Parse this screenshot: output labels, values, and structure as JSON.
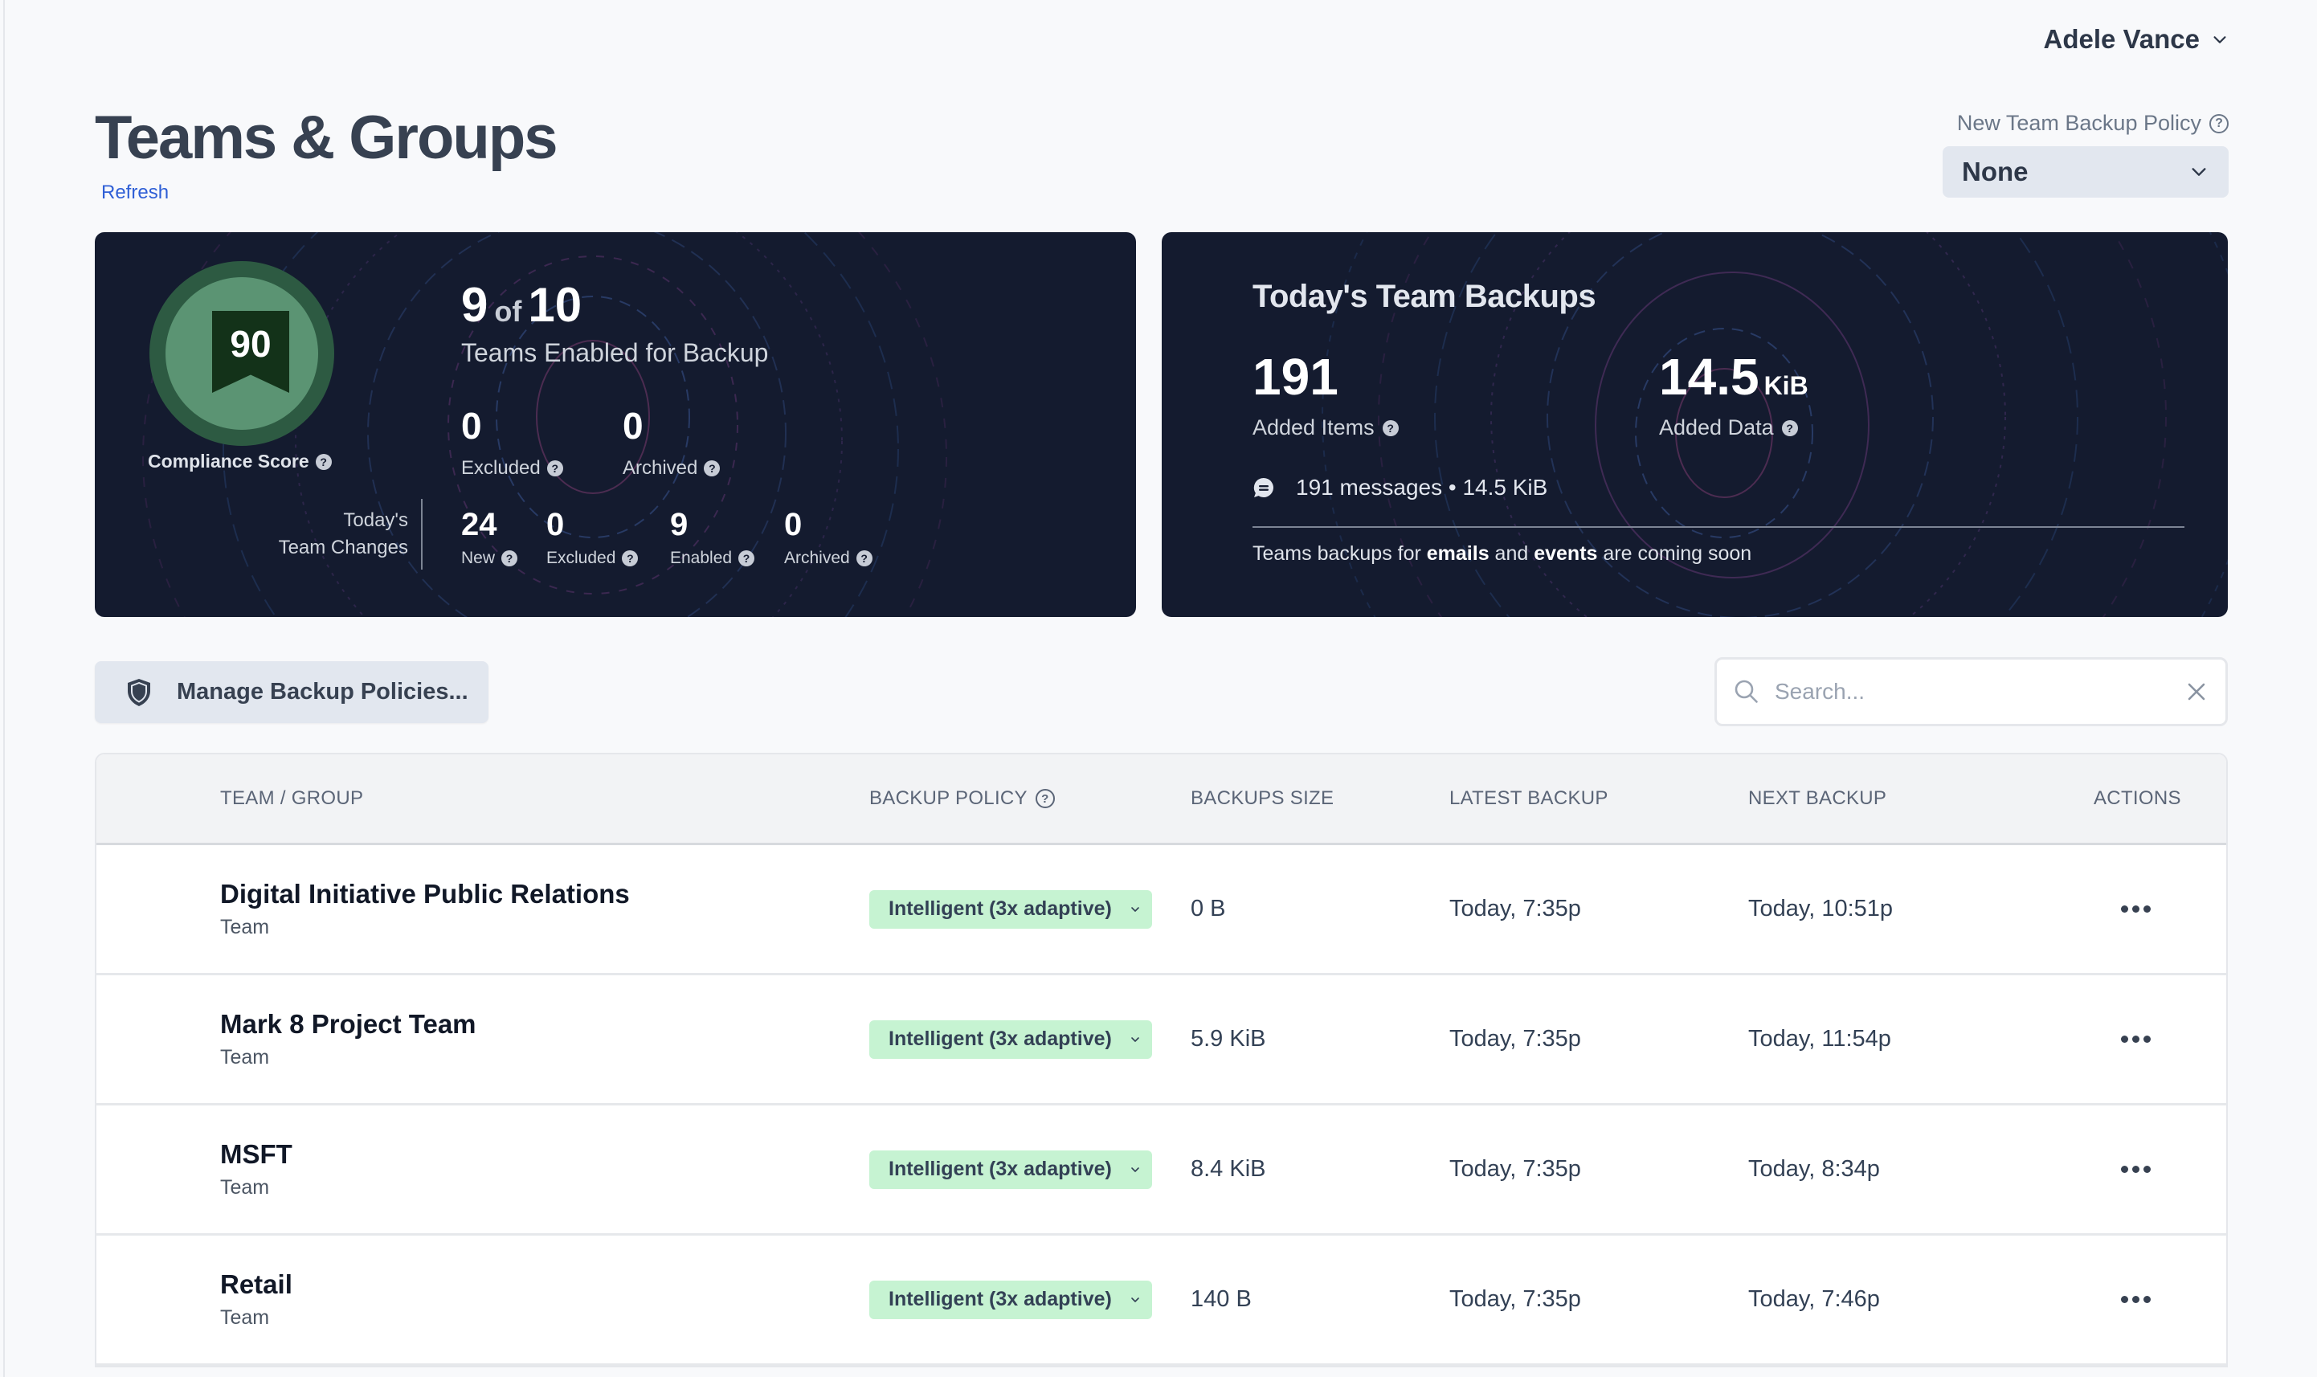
{
  "header": {
    "user_name": "Adele Vance",
    "page_title": "Teams & Groups",
    "refresh_label": "Refresh",
    "new_policy_label": "New Team Backup Policy",
    "new_policy_value": "None"
  },
  "summary": {
    "compliance_score": "90",
    "compliance_label": "Compliance Score",
    "enabled": "9",
    "of_label": "of",
    "total": "10",
    "enabled_label": "Teams Enabled for Backup",
    "excluded": {
      "value": "0",
      "label": "Excluded"
    },
    "archived": {
      "value": "0",
      "label": "Archived"
    },
    "changes_title_line1": "Today's",
    "changes_title_line2": "Team Changes",
    "changes": [
      {
        "value": "24",
        "label": "New"
      },
      {
        "value": "0",
        "label": "Excluded"
      },
      {
        "value": "9",
        "label": "Enabled"
      },
      {
        "value": "0",
        "label": "Archived"
      }
    ]
  },
  "backups": {
    "title": "Today's Team Backups",
    "added_items": {
      "value": "191",
      "label": "Added Items"
    },
    "added_data": {
      "value": "14.5",
      "unit": "KiB",
      "label": "Added Data"
    },
    "messages_line": "191 messages • 14.5 KiB",
    "note_prefix": "Teams backups for ",
    "note_bold1": "emails",
    "note_mid": " and ",
    "note_bold2": "events",
    "note_suffix": " are coming soon"
  },
  "toolbar": {
    "manage_label": "Manage Backup Policies...",
    "search_placeholder": "Search...",
    "search_value": ""
  },
  "table": {
    "columns": {
      "team": "TEAM / GROUP",
      "policy": "BACKUP POLICY",
      "size": "BACKUPS SIZE",
      "latest": "LATEST BACKUP",
      "next": "NEXT BACKUP",
      "actions": "ACTIONS"
    },
    "rows": [
      {
        "name": "Digital Initiative Public Relations",
        "type": "Team",
        "policy": "Intelligent (3x adaptive)",
        "size": "0 B",
        "latest": "Today, 7:35p",
        "next": "Today, 10:51p"
      },
      {
        "name": "Mark 8 Project Team",
        "type": "Team",
        "policy": "Intelligent (3x adaptive)",
        "size": "5.9 KiB",
        "latest": "Today, 7:35p",
        "next": "Today, 11:54p"
      },
      {
        "name": "MSFT",
        "type": "Team",
        "policy": "Intelligent (3x adaptive)",
        "size": "8.4 KiB",
        "latest": "Today, 7:35p",
        "next": "Today, 8:34p"
      },
      {
        "name": "Retail",
        "type": "Team",
        "policy": "Intelligent (3x adaptive)",
        "size": "140 B",
        "latest": "Today, 7:35p",
        "next": "Today, 7:46p"
      }
    ]
  },
  "colors": {
    "card_bg": "#141b2f",
    "policy_pill": "#c6f3d2",
    "link": "#2f5fd6",
    "badge_ring": "#2d5a42",
    "badge_inner": "#5b9473",
    "ribbon": "#133219"
  }
}
